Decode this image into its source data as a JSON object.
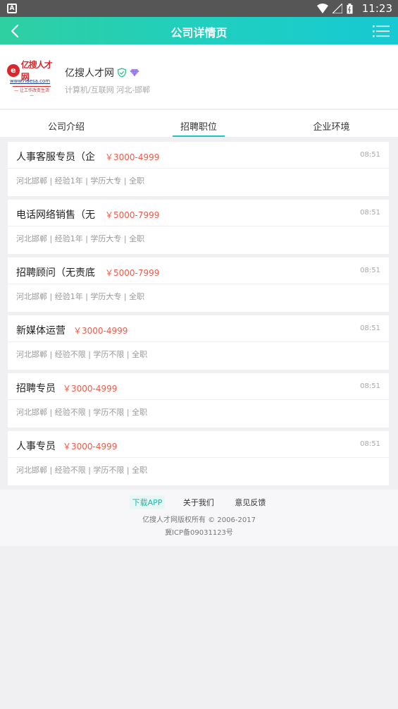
{
  "status_bar": {
    "time": "11:23",
    "app_badge": "A",
    "icons": [
      "wifi-icon",
      "signal-icon",
      "battery-icon"
    ]
  },
  "nav": {
    "title": "公司详情页",
    "back_icon": "back-arrow-icon",
    "menu_icon": "list-menu-icon"
  },
  "company": {
    "name": "亿搜人才网",
    "category": "计算机/互联网 河北-邯郸",
    "logo": {
      "text": "亿搜人才网",
      "url": "www.hdesa.com",
      "slogan": "— 让工作改变生活 —",
      "mark": "e"
    },
    "badges": [
      "verified-shield-icon",
      "diamond-icon"
    ]
  },
  "tabs": [
    "公司介绍",
    "招聘职位",
    "企业环境"
  ],
  "active_tab": "招聘职位",
  "jobs": [
    {
      "title": "人事客服专员（企",
      "salary": "￥3000-4999",
      "time": "08:51",
      "meta": "河北邯郸 | 经验1年 | 学历大专 | 全职"
    },
    {
      "title": "电话网络销售（无",
      "salary": "￥5000-7999",
      "time": "08:51",
      "meta": "河北邯郸 | 经验1年 | 学历大专 | 全职"
    },
    {
      "title": "招聘顾问（无责底",
      "salary": "￥5000-7999",
      "time": "08:51",
      "meta": "河北邯郸 | 经验1年 | 学历大专 | 全职"
    },
    {
      "title": "新媒体运营",
      "salary": "￥3000-4999",
      "time": "08:51",
      "meta": "河北邯郸 | 经验不限 | 学历不限 | 全职"
    },
    {
      "title": "招聘专员",
      "salary": "￥3000-4999",
      "time": "08:51",
      "meta": "河北邯郸 | 经验不限 | 学历不限 | 全职"
    },
    {
      "title": "人事专员",
      "salary": "￥3000-4999",
      "time": "08:51",
      "meta": "河北邯郸 | 经验不限 | 学历不限 | 全职"
    }
  ],
  "footer": {
    "links": [
      "下载APP",
      "关于我们",
      "意见反馈"
    ],
    "copyright": "亿搜人才网版权所有 © 2006-2017",
    "icp": "冀ICP备09031123号"
  },
  "colors": {
    "accent": "#21c6ba",
    "salary": "#f05a48",
    "nav_gradient_start": "#2fcfa2",
    "nav_gradient_end": "#16c9d3"
  }
}
